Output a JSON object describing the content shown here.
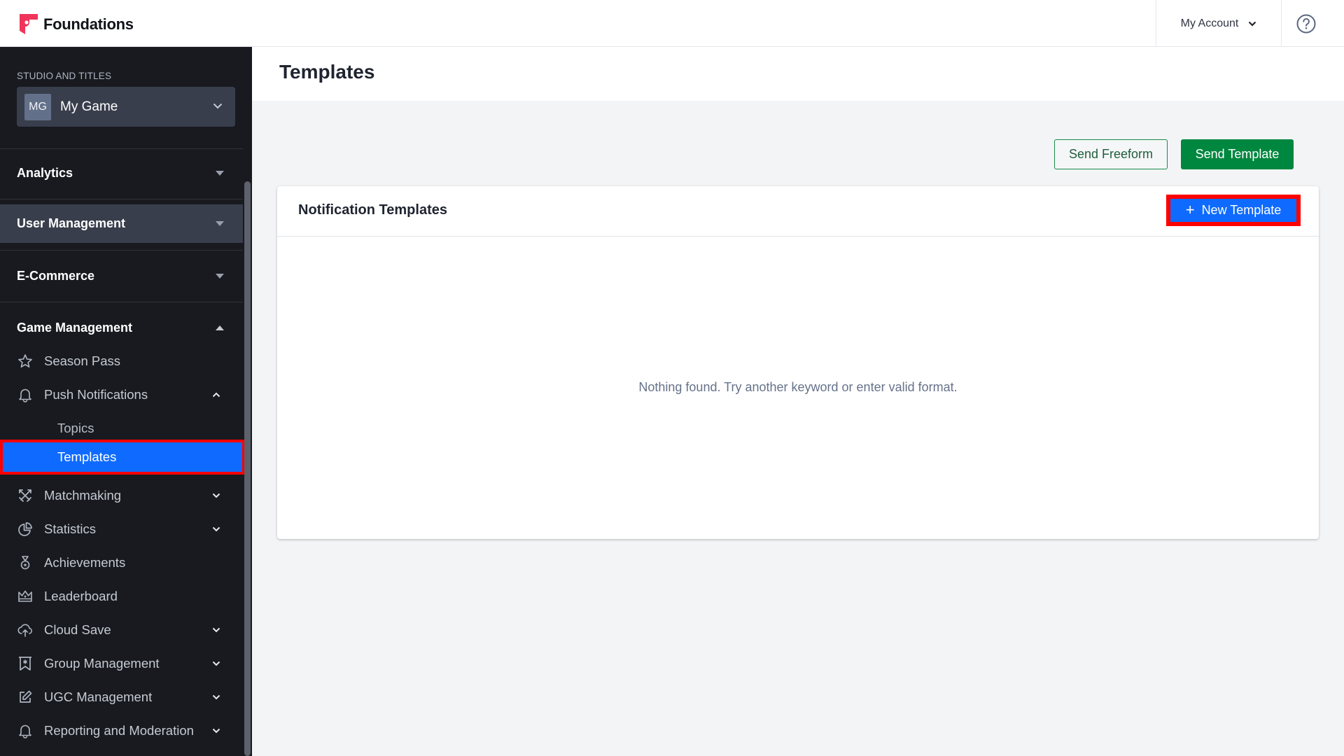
{
  "header": {
    "brand": "Foundations",
    "account_label": "My Account",
    "icons": {
      "logo": "foundations-logo-icon",
      "account_caret": "chevron-down-icon",
      "help": "help-circle-icon"
    }
  },
  "sidebar": {
    "studio_label": "STUDIO AND TITLES",
    "studio": {
      "initials": "MG",
      "name": "My Game"
    },
    "sections": [
      {
        "label": "Analytics",
        "expanded": false
      },
      {
        "label": "User Management",
        "expanded": false,
        "highlighted": true
      },
      {
        "label": "E-Commerce",
        "expanded": false
      },
      {
        "label": "Game Management",
        "expanded": true
      }
    ],
    "game_management_items": [
      {
        "label": "Season Pass",
        "icon": "star-icon",
        "has_children": false
      },
      {
        "label": "Push Notifications",
        "icon": "bell-icon",
        "has_children": true,
        "expanded": true,
        "children": [
          {
            "label": "Topics",
            "active": false
          },
          {
            "label": "Templates",
            "active": true
          }
        ]
      },
      {
        "label": "Matchmaking",
        "icon": "crossed-swords-icon",
        "has_children": true
      },
      {
        "label": "Statistics",
        "icon": "pie-chart-icon",
        "has_children": true
      },
      {
        "label": "Achievements",
        "icon": "medal-icon",
        "has_children": false
      },
      {
        "label": "Leaderboard",
        "icon": "crown-icon",
        "has_children": false
      },
      {
        "label": "Cloud Save",
        "icon": "cloud-upload-icon",
        "has_children": true
      },
      {
        "label": "Group Management",
        "icon": "banner-icon",
        "has_children": true
      },
      {
        "label": "UGC Management",
        "icon": "edit-icon",
        "has_children": true
      },
      {
        "label": "Reporting and Moderation",
        "icon": "bell-icon",
        "has_children": true
      }
    ]
  },
  "main": {
    "page_title": "Templates",
    "actions": {
      "send_freeform": "Send Freeform",
      "send_template": "Send Template"
    },
    "card": {
      "title": "Notification Templates",
      "new_button": "New Template",
      "empty_message": "Nothing found. Try another keyword or enter valid format."
    }
  },
  "colors": {
    "sidebar_bg": "#181a1f",
    "active_blue": "#0f6bff",
    "green": "#00873f",
    "highlight_red": "#ff0000",
    "brand_pink": "#f0345a"
  }
}
